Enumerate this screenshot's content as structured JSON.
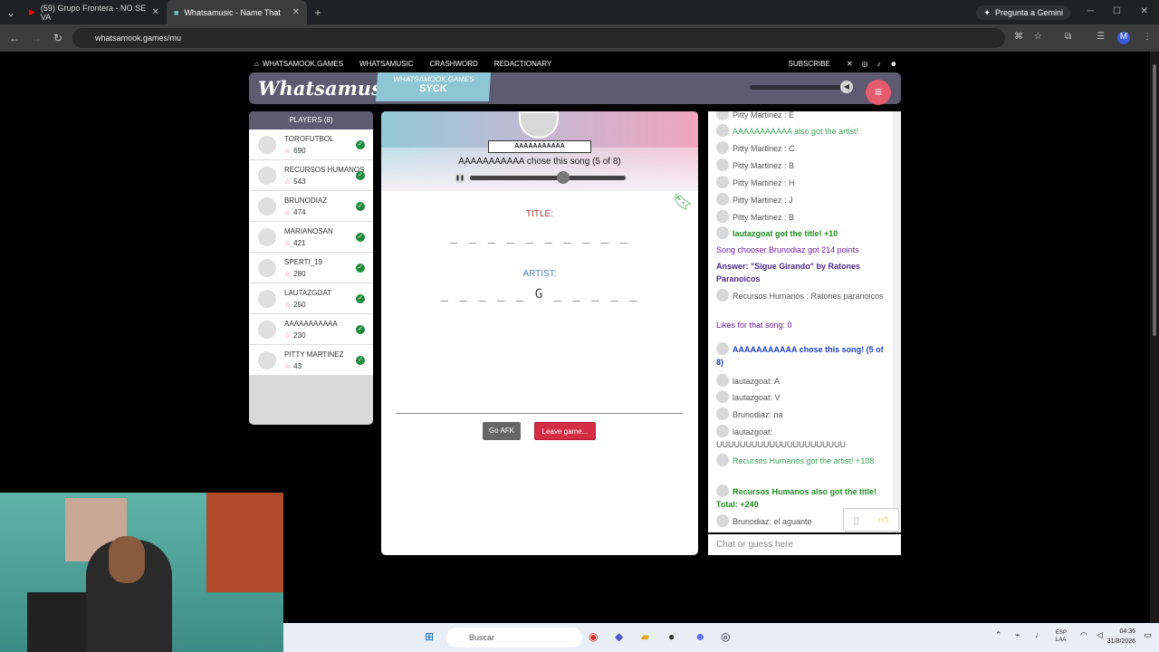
{
  "browser": {
    "tabs": [
      {
        "title": "(59) Grupo Frontera - NO SE VA",
        "favicon": "youtube-icon"
      },
      {
        "title": "Whatsamusic - Name That",
        "favicon": "whatsamook-icon"
      }
    ],
    "gemini_label": "Pregunta a Gemini",
    "url": "whatsamook.games/mu"
  },
  "site": {
    "nav": [
      "WHATSAMOOK.GAMES",
      "WHATSAMUSIC",
      "CRASHWORD",
      "REDACTIONARY"
    ],
    "subscribe": "SUBSCRIBE",
    "logo": "Whatsamusic",
    "badge_top": "WHATSAMOOK.GAMES",
    "badge_bottom": "SYCK",
    "volume_level": 0.95,
    "colors": {
      "header": "#5d5a72",
      "accent": "#e35b6c",
      "check": "#1e8a3a"
    }
  },
  "players": {
    "header": "PLAYERS (8)",
    "list": [
      {
        "name": "TOROFUTBOL",
        "points": "690"
      },
      {
        "name": "RECURSOS HUMANOS",
        "points": "543"
      },
      {
        "name": "BRUNODIAZ",
        "points": "474"
      },
      {
        "name": "MARIANOSAN",
        "points": "421"
      },
      {
        "name": "SPERTI_19",
        "points": "280"
      },
      {
        "name": "LAUTAZGOAT",
        "points": "250"
      },
      {
        "name": "AAAAAAAAAAA",
        "points": "230"
      },
      {
        "name": "PITTY MARTINEZ",
        "points": "43"
      }
    ]
  },
  "game": {
    "chooser": "AAAAAAAAAAA",
    "chose_text": "AAAAAAAAAAA chose this song (5 of 8)",
    "progress": 0.6,
    "title_label": "TITLE:",
    "title_blanks": "_ _   _ _ _ _ _ _ _ _",
    "artist_label": "ARTIST:",
    "artist_blanks": "_ _ _ _ _    G _ _ _ _ _",
    "afk_button": "Go AFK",
    "leave_button": "Leave game..."
  },
  "chat": {
    "messages": [
      {
        "text": "Pitty Martinez : E",
        "style": "gray",
        "avatar": true
      },
      {
        "text": "AAAAAAAAAAA also got the artist!",
        "style": "green",
        "avatar": true
      },
      {
        "text": "Pitty Martinez : C",
        "style": "gray",
        "avatar": true
      },
      {
        "text": "Pitty Martinez : B",
        "style": "gray",
        "avatar": true
      },
      {
        "text": "Pitty Martinez : H",
        "style": "gray",
        "avatar": true
      },
      {
        "text": "Pitty Martinez : J",
        "style": "gray",
        "avatar": true
      },
      {
        "text": "Pitty Martinez : B",
        "style": "gray",
        "avatar": true
      },
      {
        "text": "lautazgoat got the title! +10",
        "style": "bgreen",
        "avatar": true
      },
      {
        "text": "Song chooser Brunodiaz got 214 points",
        "style": "purple",
        "avatar": false
      },
      {
        "text": "Answer: \"Sigue Girando\" by Ratones Paranoicos",
        "style": "bpurple",
        "avatar": false
      },
      {
        "text": "Recursos Humanos : Ratones paranoicos",
        "style": "gray",
        "avatar": true
      },
      {
        "text": "Likes for that song: 0",
        "style": "purple",
        "avatar": false
      },
      {
        "text": "AAAAAAAAAAA chose this song! (5 of 8)",
        "style": "blue",
        "avatar": true
      },
      {
        "text": "lautazgoat: A",
        "style": "gray",
        "avatar": true
      },
      {
        "text": "lautazgoat: V",
        "style": "gray",
        "avatar": true
      },
      {
        "text": "Brunodiaz: na",
        "style": "gray",
        "avatar": true
      },
      {
        "text": "lautazgoat: UUUUUUUUUUUUUUUUUUUUUU",
        "style": "gray",
        "avatar": true
      },
      {
        "text": "Recursos Humanos got the artist! +108",
        "style": "green",
        "avatar": true
      },
      {
        "text": "Recursos Humanos also got the title! Total: +240",
        "style": "bgreen",
        "avatar": true
      },
      {
        "text": "Brunodiaz: el aguante",
        "style": "gray",
        "avatar": true
      }
    ],
    "input_placeholder": "Chat or guess here"
  },
  "taskbar": {
    "search": "Buscar",
    "lang_top": "ESP",
    "lang_bottom": "LAA",
    "time": "04:36",
    "date": "31/8/2026"
  }
}
